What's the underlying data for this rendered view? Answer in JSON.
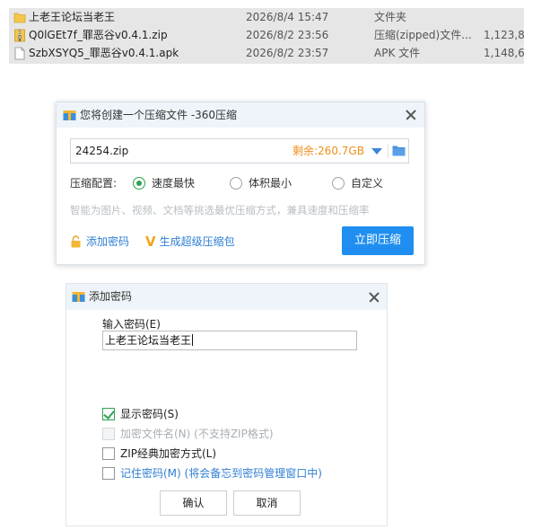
{
  "explorer": {
    "files": [
      {
        "name": "上老王论坛当老王",
        "date": "2026/8/4 15:47",
        "type": "文件夹",
        "size": "",
        "icon": "folder-icon"
      },
      {
        "name": "Q0lGEt7f_罪恶谷v0.4.1.zip",
        "date": "2026/8/2 23:56",
        "type": "压缩(zipped)文件...",
        "size": "1,123,8",
        "icon": "zip-file-icon"
      },
      {
        "name": "SzbXSYQ5_罪恶谷v0.4.1.apk",
        "date": "2026/8/2 23:57",
        "type": "APK 文件",
        "size": "1,148,6",
        "icon": "apk-file-icon"
      }
    ]
  },
  "compress_dialog": {
    "title": "您将创建一个压缩文件 -360压缩",
    "file_name": "24254.zip",
    "free_space": "剩余:260.7GB",
    "config_label": "压缩配置:",
    "options": [
      {
        "label": "速度最快",
        "selected": true
      },
      {
        "label": "体积最小",
        "selected": false
      },
      {
        "label": "自定义",
        "selected": false
      }
    ],
    "hint": "智能为图片、视频、文档等挑选最优压缩方式，兼具速度和压缩率",
    "add_password": "添加密码",
    "super_package": "生成超级压缩包",
    "compress_now": "立即压缩"
  },
  "password_dialog": {
    "title": "添加密码",
    "input_label": "输入密码(E)",
    "password_value": "上老王论坛当老王",
    "checkboxes": [
      {
        "label": "显示密码(S)",
        "checked": true,
        "enabled": true
      },
      {
        "label": "加密文件名(N) (不支持ZIP格式)",
        "checked": false,
        "enabled": false
      },
      {
        "label": "ZIP经典加密方式(L)",
        "checked": false,
        "enabled": true
      },
      {
        "label": "记住密码(M) (将会备忘到密码管理窗口中)",
        "checked": false,
        "enabled": true
      }
    ],
    "ok": "确认",
    "cancel": "取消"
  },
  "colors": {
    "accent_blue": "#1f8ef0",
    "link_blue": "#2f7fd3",
    "space_orange": "#f08d1a",
    "check_green": "#2ea44f"
  }
}
